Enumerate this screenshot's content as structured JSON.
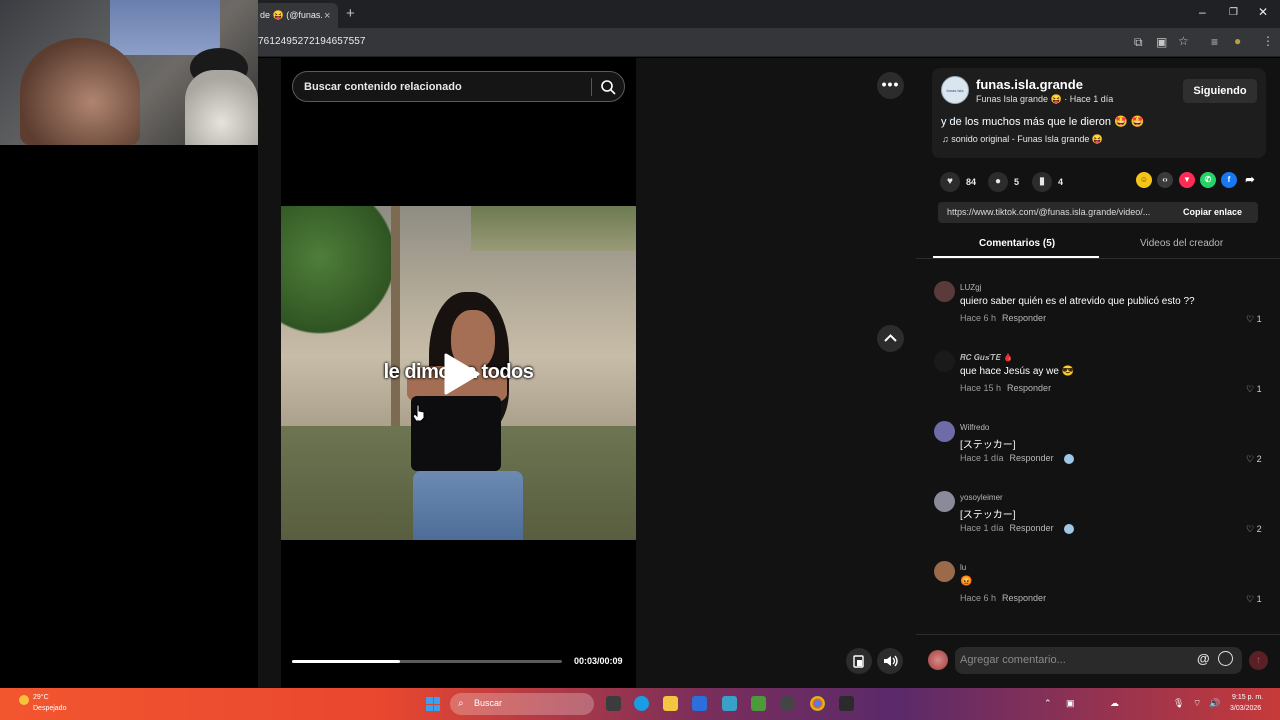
{
  "browser": {
    "tab_title": "de 😝 (@funas.i",
    "tab_close": "×",
    "new_tab": "+",
    "url": "7612495272194657557",
    "minimize": "–",
    "restore": "❐",
    "close": "✕"
  },
  "player": {
    "search_placeholder": "Buscar contenido relacionado",
    "caption": "le dimos a todos",
    "time": "00:03/00:09",
    "progress_fraction": 0.4,
    "more": "•••"
  },
  "post": {
    "username": "funas.isla.grande",
    "display_name": "Funas Isla grande 😝 · Hace 1 día",
    "follow_label": "Siguiendo",
    "description": "y de los muchos más que le dieron 🤩 🤩",
    "music": "♫  sonido original - Funas Isla grande 😝",
    "likes": "84",
    "comments": "5",
    "saves": "4",
    "link": "https://www.tiktok.com/@funas.isla.grande/video/...",
    "copy_label": "Copiar enlace",
    "tab_comments": "Comentarios (5)",
    "tab_videos": "Videos del creador",
    "avatar_text": "funas isla grande"
  },
  "comments": [
    {
      "user": "LUZgj",
      "text": "quiero saber quién es el atrevido que publicó esto ??",
      "time": "Hace 6 h",
      "reply": "Responder",
      "likes": "1",
      "avatar_color": "#5a3a3a"
    },
    {
      "user": "𝑹𝑪 𝑮𝒖𝒔'𝑻𝑬 🩸",
      "text": "que hace Jesús ay we 😎",
      "time": "Hace 15 h",
      "reply": "Responder",
      "likes": "1",
      "avatar_color": "#1a1a1a"
    },
    {
      "user": "Wilfredo",
      "text": "[ステッカー]",
      "time": "Hace 1 día",
      "reply": "Responder",
      "likes": "2",
      "avatar_color": "#6f6aa8"
    },
    {
      "user": "yosoyleimer",
      "text": "[ステッカー]",
      "time": "Hace 1 día",
      "reply": "Responder",
      "likes": "2",
      "avatar_color": "#8a8a9a"
    },
    {
      "user": "lu",
      "text": "😡",
      "time": "Hace 6 h",
      "reply": "Responder",
      "likes": "1",
      "avatar_color": "#9a6a4a"
    }
  ],
  "comment_bar": {
    "placeholder": "Agregar comentario...",
    "at": "@"
  },
  "taskbar": {
    "temp": "29°C",
    "weather": "Despejado",
    "search_label": "Buscar",
    "time": "9:15 p. m.",
    "date": "3/03/2026"
  }
}
